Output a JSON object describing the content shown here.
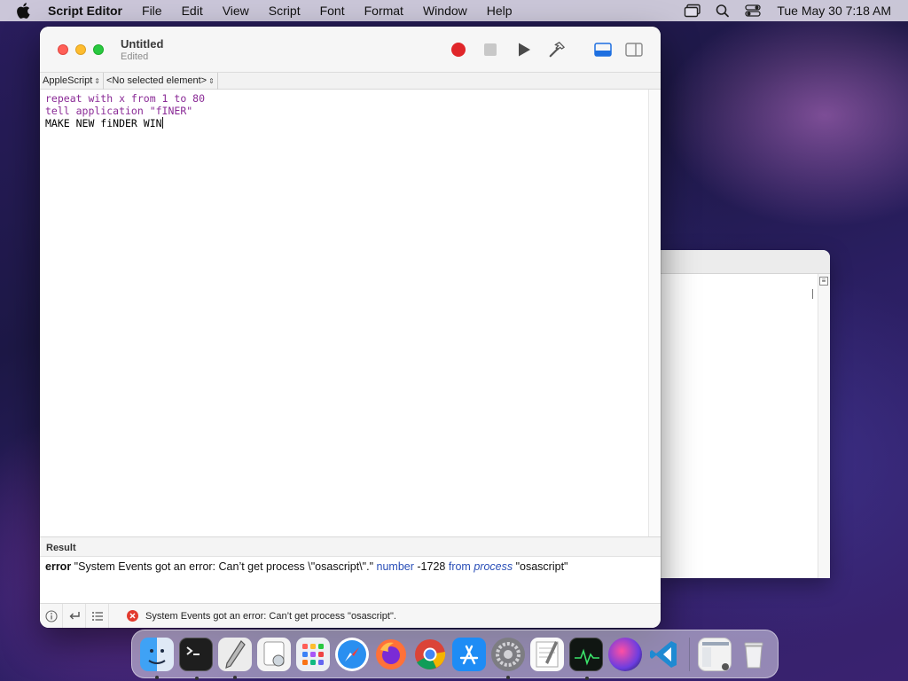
{
  "menubar": {
    "app_name": "Script Editor",
    "items": [
      "File",
      "Edit",
      "View",
      "Script",
      "Font",
      "Format",
      "Window",
      "Help"
    ],
    "clock": "Tue May 30  7:18 AM"
  },
  "window": {
    "title": "Untitled",
    "subtitle": "Edited",
    "navbar": {
      "language": "AppleScript",
      "element": "<No selected element>"
    },
    "code": {
      "line1": "repeat with x from 1 to 80",
      "line2": "tell application \"fINER\"",
      "line3": "MAKE NEW fiNDER WIN"
    },
    "result": {
      "header": "Result",
      "error_kw": "error",
      "error_msg": "\"System Events got an error: Can’t get process \\\"osascript\\\".\"",
      "number_kw": "number",
      "number_val": "-1728",
      "from_kw": "from",
      "process_kw": "process",
      "process_val": "\"osascript\""
    },
    "status": {
      "message": "System Events got an error: Can’t get process \"osascript\"."
    }
  },
  "dock": {
    "apps": [
      "Finder",
      "Terminal",
      "Script Editor",
      "Preview",
      "Launchpad",
      "Safari",
      "Firefox",
      "Chrome",
      "App Store",
      "System Preferences",
      "TextEdit",
      "Activity Monitor",
      "Siri",
      "Visual Studio Code",
      "Screenshot",
      "Trash"
    ]
  }
}
